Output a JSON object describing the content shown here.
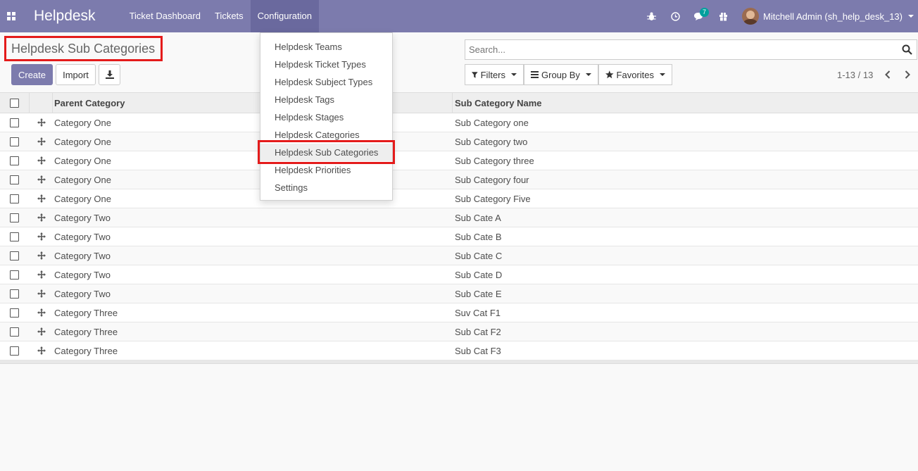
{
  "navbar": {
    "brand": "Helpdesk",
    "menu": [
      "Ticket Dashboard",
      "Tickets",
      "Configuration"
    ],
    "active_menu": "Configuration",
    "chat_badge": "7",
    "user_name": "Mitchell Admin (sh_help_desk_13)",
    "colors": {
      "navbar": "#7c7bad",
      "badge": "#00a09d"
    }
  },
  "control_panel": {
    "breadcrumb": "Helpdesk Sub Categories",
    "create_label": "Create",
    "import_label": "Import",
    "search_placeholder": "Search...",
    "filters_label": "Filters",
    "group_by_label": "Group By",
    "favorites_label": "Favorites",
    "pager": "1-13 / 13"
  },
  "config_menu": {
    "items": [
      "Helpdesk Teams",
      "Helpdesk Ticket Types",
      "Helpdesk Subject Types",
      "Helpdesk Tags",
      "Helpdesk Stages",
      "Helpdesk Categories",
      "Helpdesk Sub Categories",
      "Helpdesk Priorities",
      "Settings"
    ],
    "active_item": "Helpdesk Sub Categories"
  },
  "table": {
    "headers": {
      "parent": "Parent Category",
      "sub": "Sub Category Name"
    },
    "rows": [
      {
        "parent": "Category One",
        "sub": "Sub Category one"
      },
      {
        "parent": "Category One",
        "sub": "Sub Category two"
      },
      {
        "parent": "Category One",
        "sub": "Sub Category three"
      },
      {
        "parent": "Category One",
        "sub": "Sub Category four"
      },
      {
        "parent": "Category One",
        "sub": "Sub Category Five"
      },
      {
        "parent": "Category Two",
        "sub": "Sub Cate A"
      },
      {
        "parent": "Category Two",
        "sub": "Sub Cate B"
      },
      {
        "parent": "Category Two",
        "sub": "Sub Cate C"
      },
      {
        "parent": "Category Two",
        "sub": "Sub Cate D"
      },
      {
        "parent": "Category Two",
        "sub": "Sub Cate E"
      },
      {
        "parent": "Category Three",
        "sub": "Suv Cat F1"
      },
      {
        "parent": "Category Three",
        "sub": "Sub Cat F2"
      },
      {
        "parent": "Category Three",
        "sub": "Sub Cat F3"
      }
    ]
  },
  "annotation_color": "#e41b1b"
}
